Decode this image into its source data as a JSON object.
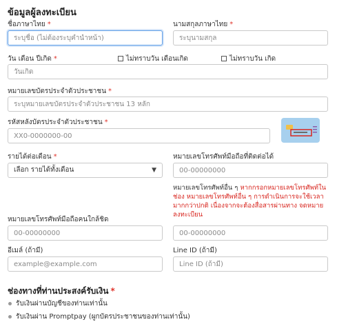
{
  "section_title": "ข้อมูลผู้ลงทะเบียน",
  "first_name": {
    "label": "ชื่อภาษาไทย",
    "required": "*",
    "placeholder": "ระบุชื่อ (ไม่ต้องระบุคำนำหน้า)"
  },
  "last_name": {
    "label": "นามสกุลภาษาไทย",
    "required": "*",
    "placeholder": "ระบุนามสกุล"
  },
  "birth_date": {
    "label": "วัน เดือน ปีเกิด",
    "required": "*",
    "placeholder": "วันเกิด",
    "unknown_day_month": "ไม่ทราบวัน เดือนเกิด",
    "unknown_day": "ไม่ทราบวัน เกิด"
  },
  "id_number": {
    "label": "หมายเลขบัตรประจำตัวประชาชน",
    "required": "*",
    "placeholder": "ระบุหมายเลขบัตรประจำตัวประชาชน 13 หลัก"
  },
  "laser_code": {
    "label": "รหัสหลังบัตรประจำตัวประชาชน",
    "required": "*",
    "placeholder": "XX0-0000000-00"
  },
  "income": {
    "label": "รายได้ต่อเดือน",
    "required": "*",
    "selected": "เลือก รายได้ทั้งเดือน"
  },
  "mobile": {
    "label": "หมายเลขโทรศัพท์มือถือที่ติดต่อได้",
    "placeholder": "00-00000000"
  },
  "other_phone": {
    "label": "หมายเลขโทรศัพท์อื่น ๆ",
    "warning": "หากกรอกหมายเลขโทรศัพท์ในช่อง หมายเลขโทรศัพท์อื่น ๆ การดำเนินการจะใช้เวลามากกว่าปกติ เนื่องจากจะต้องสื่อสารผ่านทาง จดหมายลงทะเบียน",
    "placeholder": "00-00000000"
  },
  "relative_phone": {
    "label": "หมายเลขโทรศัพท์มือถือคนใกล้ชิด",
    "placeholder": "00-00000000"
  },
  "email": {
    "label": "อีเมล์ (ถ้ามี)",
    "placeholder": "example@example.com"
  },
  "line_id": {
    "label": "Line ID (ถ้ามี)",
    "placeholder": "Line ID (ถ้ามี)"
  },
  "payment": {
    "title": "ช่องทางที่ท่านประสงค์รับเงิน",
    "required": "*",
    "options": [
      "รับเงินผ่านบัญชีของท่านเท่านั้น",
      "รับเงินผ่าน Promptpay (ผูกบัตรประชาชนของท่านเท่านั้น)"
    ]
  },
  "colors": {
    "required": "#e0342b",
    "focus_border": "#5b9be6",
    "card_bg": "#a7d0ee",
    "card_chip": "#f0c04a",
    "card_highlight": "#d8261f"
  },
  "icons": {
    "card": "id-card-back-icon",
    "caret": "caret-down-icon"
  }
}
